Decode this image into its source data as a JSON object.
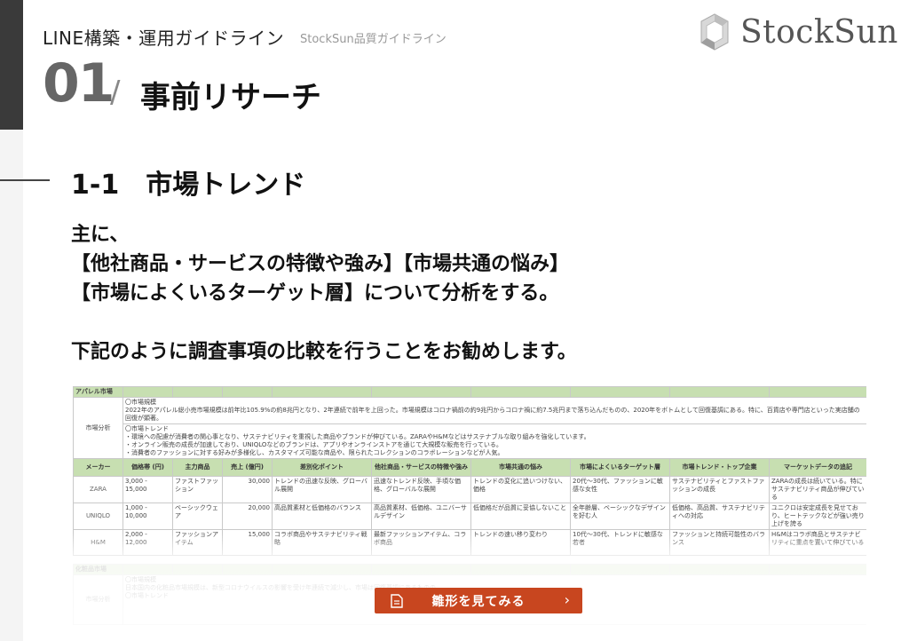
{
  "header": {
    "title": "LINE構築・運用ガイドライン",
    "subtitle": "StockSun品質ガイドライン"
  },
  "logo": {
    "text": "StockSun"
  },
  "section": {
    "number": "01",
    "slash": "/",
    "title": "事前リサーチ"
  },
  "subsection": {
    "title": "1-1　市場トレンド"
  },
  "body": {
    "lines": [
      "主に、",
      "【他社商品・サービスの特徴や強み】【市場共通の悩み】",
      "【市場によくいるターゲット層】について分析をする。",
      "",
      "下記のように調査事項の比較を行うことをお勧めします。"
    ]
  },
  "table": {
    "section1_label": "アパレル市場",
    "analysis_label": "市場分析",
    "analysis_blocks": [
      "〇市場規模\n2022年のアパレル総小売市場規模は前年比105.9%の約8兆円となり、2年連続で前年を上回った。市場規模はコロナ禍前の約9兆円からコロナ禍に約7.5兆円まで落ち込んだものの、2020年をボトムとして回復基調にある。特に、百貨店や専門店といった実店舗の回復が顕著。",
      "〇市場トレンド\n・環境への配慮が消費者の関心事となり、サステナビリティを重視した商品やブランドが伸びている。ZARAやH&Mなどはサステナブルな取り組みを強化しています。\n・オンライン販売の成長が加速しており、UNIQLOなどのブランドは、アプリやオンラインストアを通じて大規模な販売を行っている。\n・消費者のファッションに対する好みが多様化し、カスタマイズ可能な商品や、限られたコレクションのコラボレーションなどが人気。"
    ],
    "columns": [
      "メーカー",
      "価格帯 (円)",
      "主力商品",
      "売上 (億円)",
      "差別化ポイント",
      "他社商品・サービスの特徴や強み",
      "市場共通の悩み",
      "市場によくいるターゲット層",
      "市場トレンド・トップ企業",
      "マーケットデータの追記"
    ],
    "rows": [
      [
        "ZARA",
        "3,000 - 15,000",
        "ファストファッション",
        "30,000",
        "トレンドの迅速な反映、グローバル展開",
        "迅速なトレンド反映、手頃な価格、グローバルな展開",
        "トレンドの変化に追いつけない、価格",
        "20代〜30代、ファッションに敏感な女性",
        "サステナビリティとファストファッションの成長",
        "ZARAの成長は続いている。特にサステナビリティ商品が伸びている"
      ],
      [
        "UNIQLO",
        "1,000 - 10,000",
        "ベーシックウェア",
        "20,000",
        "高品質素材と低価格のバランス",
        "高品質素材、低価格、ユニバーサルデザイン",
        "低価格だが品質に妥協しないこと",
        "全年齢層、ベーシックなデザインを好む人",
        "低価格、高品質、サステナビリティへの対応",
        "ユニクロは安定成長を見せており、ヒートテックなどが強い売り上げを誇る"
      ],
      [
        "H&M",
        "2,000 - 12,000",
        "ファッションアイテム",
        "15,000",
        "コラボ商品やサステナビリティ戦略",
        "最新ファッションアイテム、コラボ商品",
        "トレンドの速い移り変わり",
        "10代〜30代、トレンドに敏感な若者",
        "ファッションと持続可能性のバランス",
        "H&Mはコラボ商品とサステナビリティに重点を置いて伸びている"
      ]
    ],
    "section2_label": "化粧品市場",
    "section2_analysis_label": "市場分析",
    "section2_text": "〇市場規模\n日本国内の化粧品市場規模は、新型コロナウイルスの影響を受け年連続で減少し、市場は回復基調にあるものの\n〇市場トレンド"
  },
  "cta": {
    "label": "雛形を見てみる",
    "arrow": "›"
  },
  "colors": {
    "accent": "#c8461f",
    "table_header": "#c7dfb1",
    "left_bar": "#3a3a3a"
  }
}
